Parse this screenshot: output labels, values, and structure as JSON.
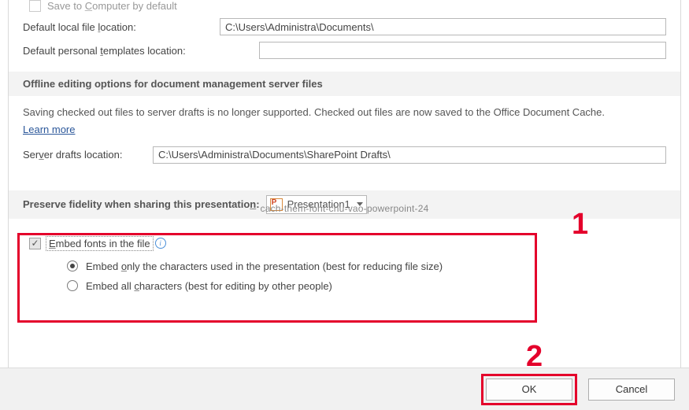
{
  "save": {
    "save_default_label_pre": "Save to ",
    "save_default_label_u": "C",
    "save_default_label_post": "omputer by default",
    "local_label_pre": "Default local file ",
    "local_label_u": "l",
    "local_label_post": "ocation:",
    "local_value": "C:\\Users\\Administra\\Documents\\",
    "templates_label_pre": "Default personal ",
    "templates_label_u": "t",
    "templates_label_post": "emplates location:",
    "templates_value": ""
  },
  "offline": {
    "header": "Offline editing options for document management server files",
    "body": "Saving checked out files to server drafts is no longer supported. Checked out files are now saved to the Office Document Cache.",
    "learn_more": "Learn more",
    "drafts_label_pre": "Ser",
    "drafts_label_u": "v",
    "drafts_label_post": "er drafts location:",
    "drafts_value": "C:\\Users\\Administra\\Documents\\SharePoint Drafts\\"
  },
  "preserve": {
    "header_pre": "Preserve fidelity when sharing this presentatio",
    "header_u": "n",
    "header_post": ":",
    "dropdown_value": "Presentation1"
  },
  "embed": {
    "checkbox_label_pre": "",
    "checkbox_label_u": "E",
    "checkbox_label_post": "mbed fonts in the file",
    "opt1_pre": "Embed ",
    "opt1_u": "o",
    "opt1_post": "nly the characters used in the presentation (best for reducing file size)",
    "opt2_pre": "Embed all ",
    "opt2_u": "c",
    "opt2_post": "haracters (best for editing by other people)"
  },
  "footer": {
    "ok": "OK",
    "cancel": "Cancel"
  },
  "watermark": "cach-them-font-chu-vao-powerpoint-24",
  "markers": {
    "one": "1",
    "two": "2"
  },
  "colors": {
    "accent_red": "#e4002b",
    "link": "#2b579a"
  }
}
